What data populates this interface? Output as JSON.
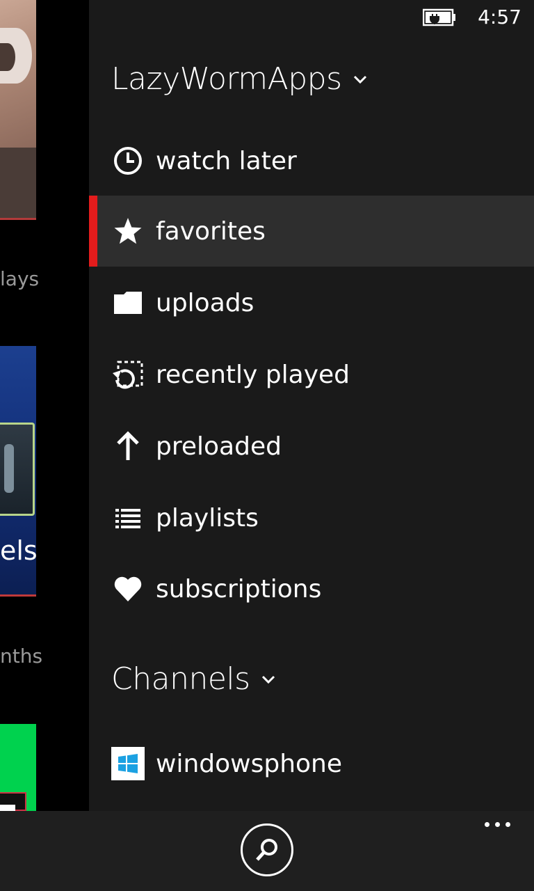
{
  "status": {
    "time": "4:57",
    "battery_icon": "battery-charging-icon"
  },
  "background": {
    "label_1": "lays",
    "tile_label": "els",
    "label_2": "nths",
    "colors": {
      "blue_tile": "#13307a",
      "green_tile": "#00d24e"
    }
  },
  "nav": {
    "account_header": "LazyWormApps",
    "items": [
      {
        "label": "watch later",
        "icon": "clock-icon"
      },
      {
        "label": "favorites",
        "icon": "star-icon",
        "selected": true
      },
      {
        "label": "uploads",
        "icon": "folder-icon"
      },
      {
        "label": "recently played",
        "icon": "recent-icon"
      },
      {
        "label": "preloaded",
        "icon": "arrow-up-icon"
      },
      {
        "label": "playlists",
        "icon": "list-icon"
      },
      {
        "label": "subscriptions",
        "icon": "heart-icon"
      }
    ],
    "channels_header": "Channels",
    "channels": [
      {
        "label": "windowsphone",
        "icon": "windows-logo-icon"
      }
    ]
  },
  "app_bar": {
    "search_icon": "search-icon",
    "more_icon": "more-icon"
  },
  "colors": {
    "accent": "#e31c1c",
    "pane_bg": "#1a1a1a",
    "selected_bg": "#2e2e2e"
  }
}
